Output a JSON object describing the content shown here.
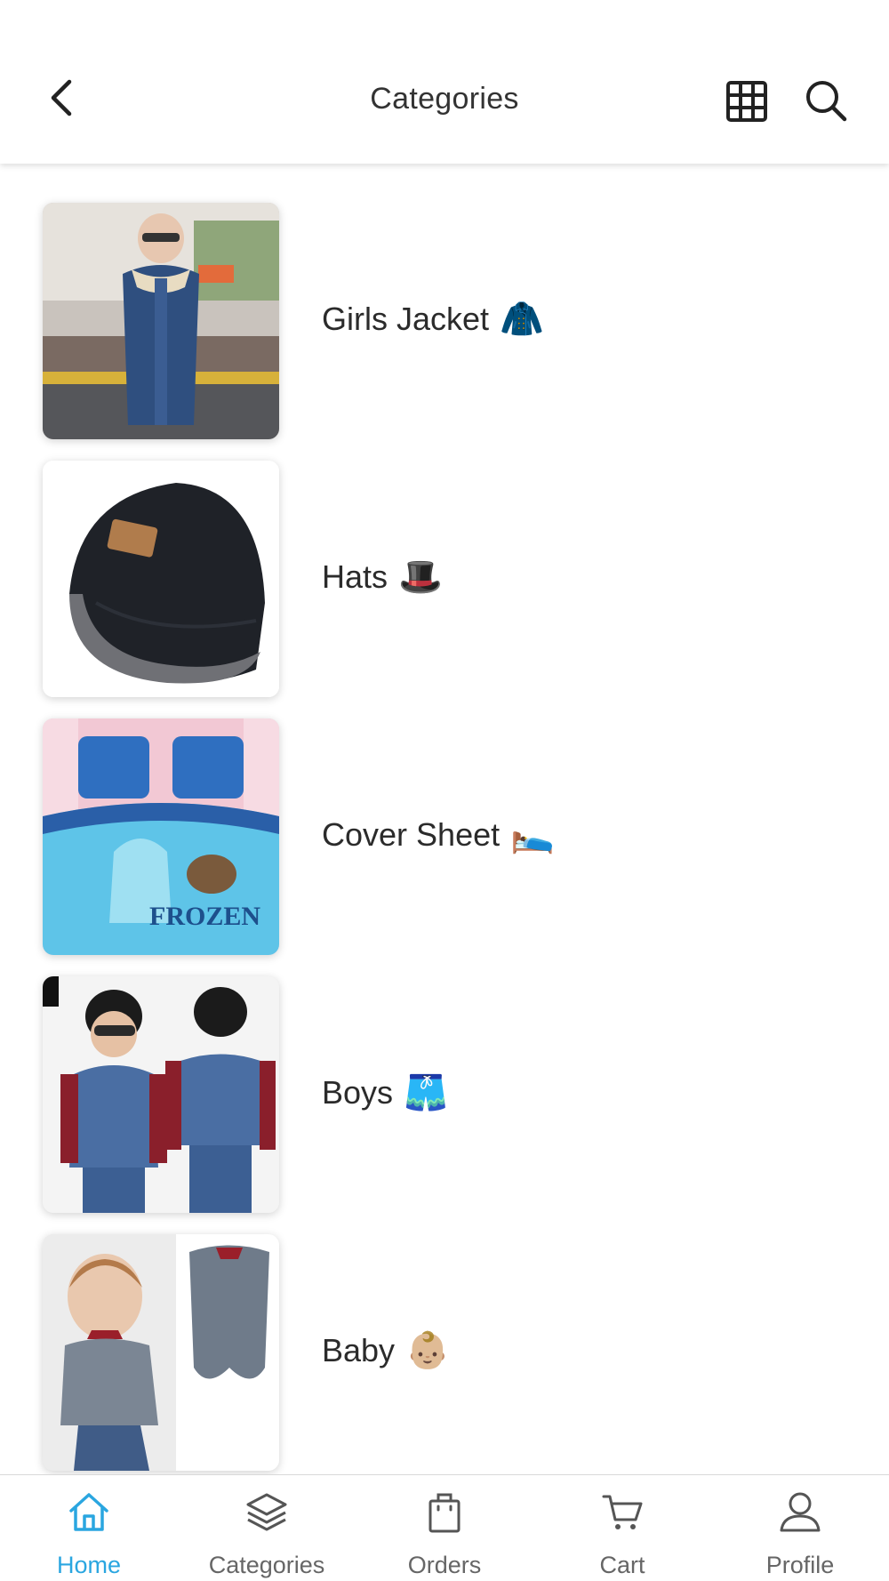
{
  "header": {
    "title": "Categories",
    "back_icon": "chevron-left-icon",
    "grid_icon": "grid-icon",
    "search_icon": "search-icon"
  },
  "categories": [
    {
      "label": "Girls Jacket",
      "emoji": "🧥"
    },
    {
      "label": "Hats",
      "emoji": "🎩"
    },
    {
      "label": "Cover Sheet",
      "emoji": "🛌"
    },
    {
      "label": "Boys",
      "emoji": "🩳"
    },
    {
      "label": "Baby",
      "emoji": "👶🏼"
    }
  ],
  "bottom_nav": {
    "active_color": "#2aa6e0",
    "items": [
      {
        "label": "Home",
        "icon": "home-icon",
        "active": true
      },
      {
        "label": "Categories",
        "icon": "layers-icon",
        "active": false
      },
      {
        "label": "Orders",
        "icon": "shopping-bag-icon",
        "active": false
      },
      {
        "label": "Cart",
        "icon": "cart-icon",
        "active": false
      },
      {
        "label": "Profile",
        "icon": "user-icon",
        "active": false
      }
    ]
  }
}
